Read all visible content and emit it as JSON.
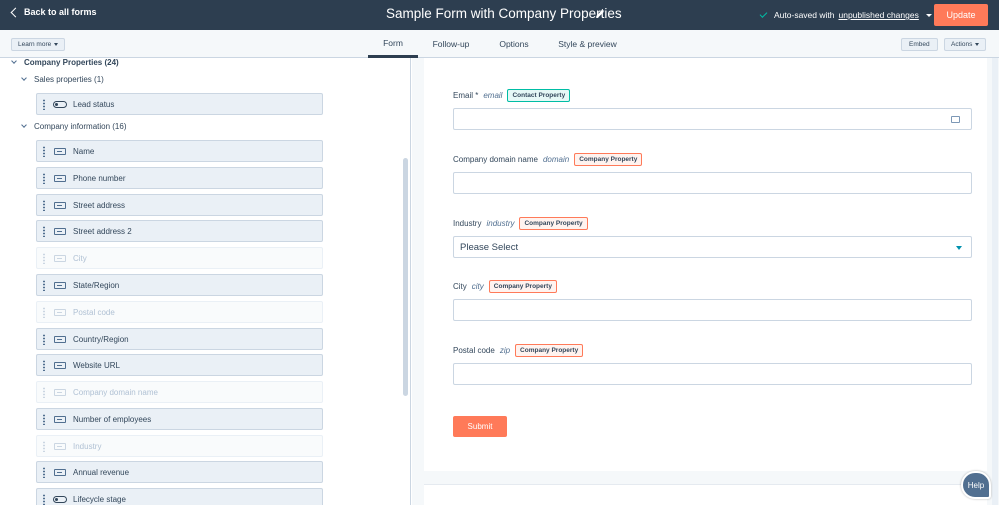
{
  "topbar": {
    "back_label": "Back to all forms",
    "form_title": "Sample Form with Company Properties",
    "autosave_prefix": "Auto-saved with",
    "autosave_link": "unpublished changes",
    "update_label": "Update"
  },
  "subbar": {
    "learn_more": "Learn more",
    "tabs": [
      {
        "label": "Form",
        "active": true
      },
      {
        "label": "Follow-up",
        "active": false
      },
      {
        "label": "Options",
        "active": false
      },
      {
        "label": "Style & preview",
        "active": false
      }
    ],
    "embed_label": "Embed",
    "actions_label": "Actions"
  },
  "sidebar": {
    "root": "Company Properties (24)",
    "groups": [
      {
        "title": "Sales properties (1)",
        "fields": [
          {
            "label": "Lead status",
            "icon": "toggle-icon",
            "disabled": false
          }
        ]
      },
      {
        "title": "Company information (16)",
        "fields": [
          {
            "label": "Name",
            "icon": "text-field-icon",
            "disabled": false
          },
          {
            "label": "Phone number",
            "icon": "text-field-icon",
            "disabled": false
          },
          {
            "label": "Street address",
            "icon": "text-field-icon",
            "disabled": false
          },
          {
            "label": "Street address 2",
            "icon": "text-field-icon",
            "disabled": false
          },
          {
            "label": "City",
            "icon": "text-field-icon",
            "disabled": true
          },
          {
            "label": "State/Region",
            "icon": "text-field-icon",
            "disabled": false
          },
          {
            "label": "Postal code",
            "icon": "text-field-icon",
            "disabled": true
          },
          {
            "label": "Country/Region",
            "icon": "text-field-icon",
            "disabled": false
          },
          {
            "label": "Website URL",
            "icon": "text-field-icon",
            "disabled": false
          },
          {
            "label": "Company domain name",
            "icon": "text-field-icon",
            "disabled": true
          },
          {
            "label": "Number of employees",
            "icon": "text-field-icon",
            "disabled": false
          },
          {
            "label": "Industry",
            "icon": "text-field-icon",
            "disabled": true
          },
          {
            "label": "Annual revenue",
            "icon": "text-field-icon",
            "disabled": false
          },
          {
            "label": "Lifecycle stage",
            "icon": "toggle-icon",
            "disabled": false
          }
        ]
      }
    ]
  },
  "form": {
    "fields": [
      {
        "label": "Email *",
        "internal": "email",
        "badge": "Contact Property",
        "type": "text"
      },
      {
        "label": "Company domain name",
        "internal": "domain",
        "badge": "Company Property",
        "type": "text"
      },
      {
        "label": "Industry",
        "internal": "industry",
        "badge": "Company Property",
        "type": "select",
        "value": "Please Select"
      },
      {
        "label": "City",
        "internal": "city",
        "badge": "Company Property",
        "type": "text"
      },
      {
        "label": "Postal code",
        "internal": "zip",
        "badge": "Company Property",
        "type": "text"
      }
    ],
    "submit_label": "Submit"
  },
  "help_label": "Help",
  "colors": {
    "topbar": "#2d3e50",
    "accent": "#ff7a59",
    "contact_badge": "#00bda5"
  }
}
